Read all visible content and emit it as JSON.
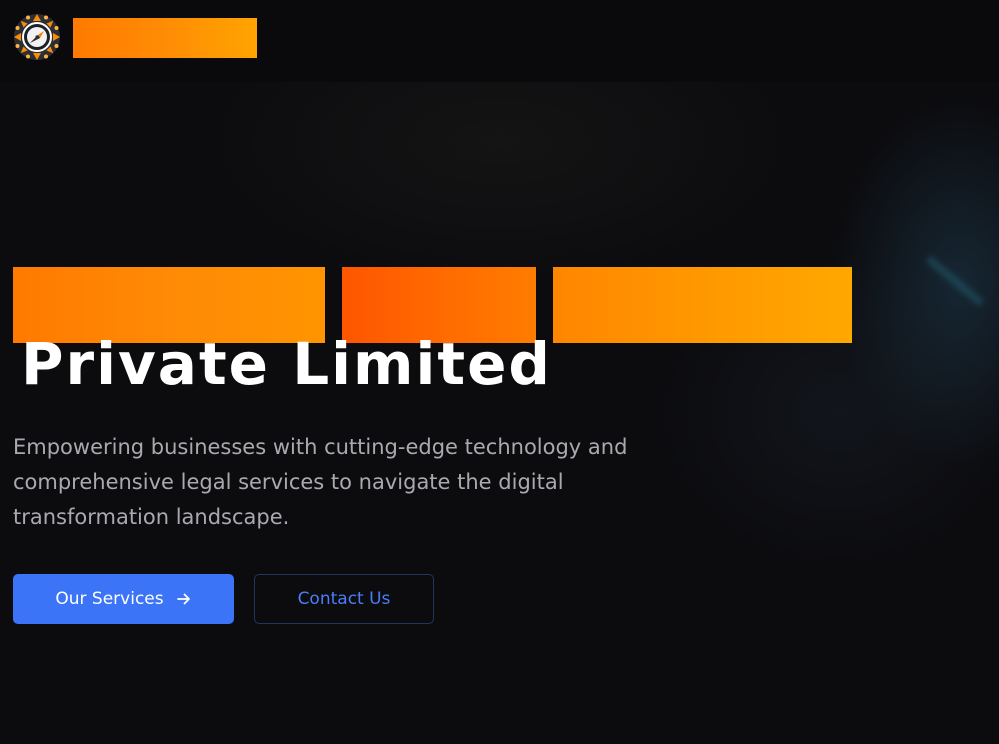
{
  "header": {
    "logo_icon": "compass-logo-icon",
    "brand_name_redacted": true,
    "colors": {
      "brand_orange": "#ff8c05",
      "brand_orange_light": "#ffa400"
    }
  },
  "hero": {
    "title_line1_redacted": true,
    "title_line2": "Private Limited",
    "subtitle": "Empowering businesses with cutting-edge technology and comprehensive legal services to navigate the digital transformation landscape.",
    "primary_button": {
      "label": "Our Services",
      "icon": "arrow-right-icon"
    },
    "secondary_button": {
      "label": "Contact Us"
    },
    "colors": {
      "background": "#0a0a0c",
      "primary_button": "#3b74f6",
      "secondary_text": "#4a7df7",
      "subtitle_text": "#a9aab0"
    }
  }
}
